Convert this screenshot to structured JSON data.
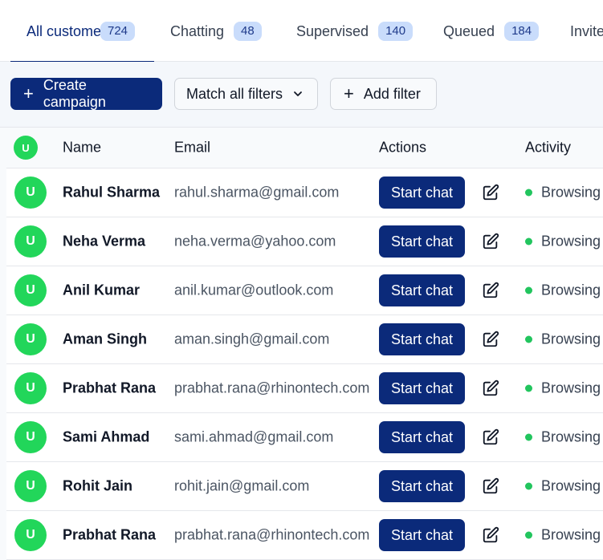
{
  "tabs": [
    {
      "label": "All customers",
      "count": "724",
      "active": true
    },
    {
      "label": "Chatting",
      "count": "48"
    },
    {
      "label": "Supervised",
      "count": "140"
    },
    {
      "label": "Queued",
      "count": "184"
    },
    {
      "label": "Invite"
    }
  ],
  "toolbar": {
    "create_campaign": "Create campaign",
    "match_filters": "Match all filters",
    "add_filter": "Add filter"
  },
  "table": {
    "header": {
      "avatar": "U",
      "name": "Name",
      "email": "Email",
      "actions": "Actions",
      "activity": "Activity"
    },
    "rows": [
      {
        "avatar": "U",
        "name": "Rahul Sharma",
        "email": "rahul.sharma@gmail.com",
        "action": "Start chat",
        "activity": "Browsing"
      },
      {
        "avatar": "U",
        "name": "Neha Verma",
        "email": "neha.verma@yahoo.com",
        "action": "Start chat",
        "activity": "Browsing"
      },
      {
        "avatar": "U",
        "name": "Anil Kumar",
        "email": "anil.kumar@outlook.com",
        "action": "Start chat",
        "activity": "Browsing"
      },
      {
        "avatar": "U",
        "name": "Aman Singh",
        "email": "aman.singh@gmail.com",
        "action": "Start chat",
        "activity": "Browsing"
      },
      {
        "avatar": "U",
        "name": "Prabhat Rana",
        "email": "prabhat.rana@rhinontech.com",
        "action": "Start chat",
        "activity": "Browsing"
      },
      {
        "avatar": "U",
        "name": "Sami Ahmad",
        "email": "sami.ahmad@gmail.com",
        "action": "Start chat",
        "activity": "Browsing"
      },
      {
        "avatar": "U",
        "name": "Rohit Jain",
        "email": "rohit.jain@gmail.com",
        "action": "Start chat",
        "activity": "Browsing"
      },
      {
        "avatar": "U",
        "name": "Prabhat Rana",
        "email": "prabhat.rana@rhinontech.com",
        "action": "Start chat",
        "activity": "Browsing"
      }
    ]
  },
  "colors": {
    "primary": "#0b2a7a",
    "avatar": "#22d65a",
    "status_online": "#22c55e",
    "badge_bg": "#c9dcfb"
  }
}
